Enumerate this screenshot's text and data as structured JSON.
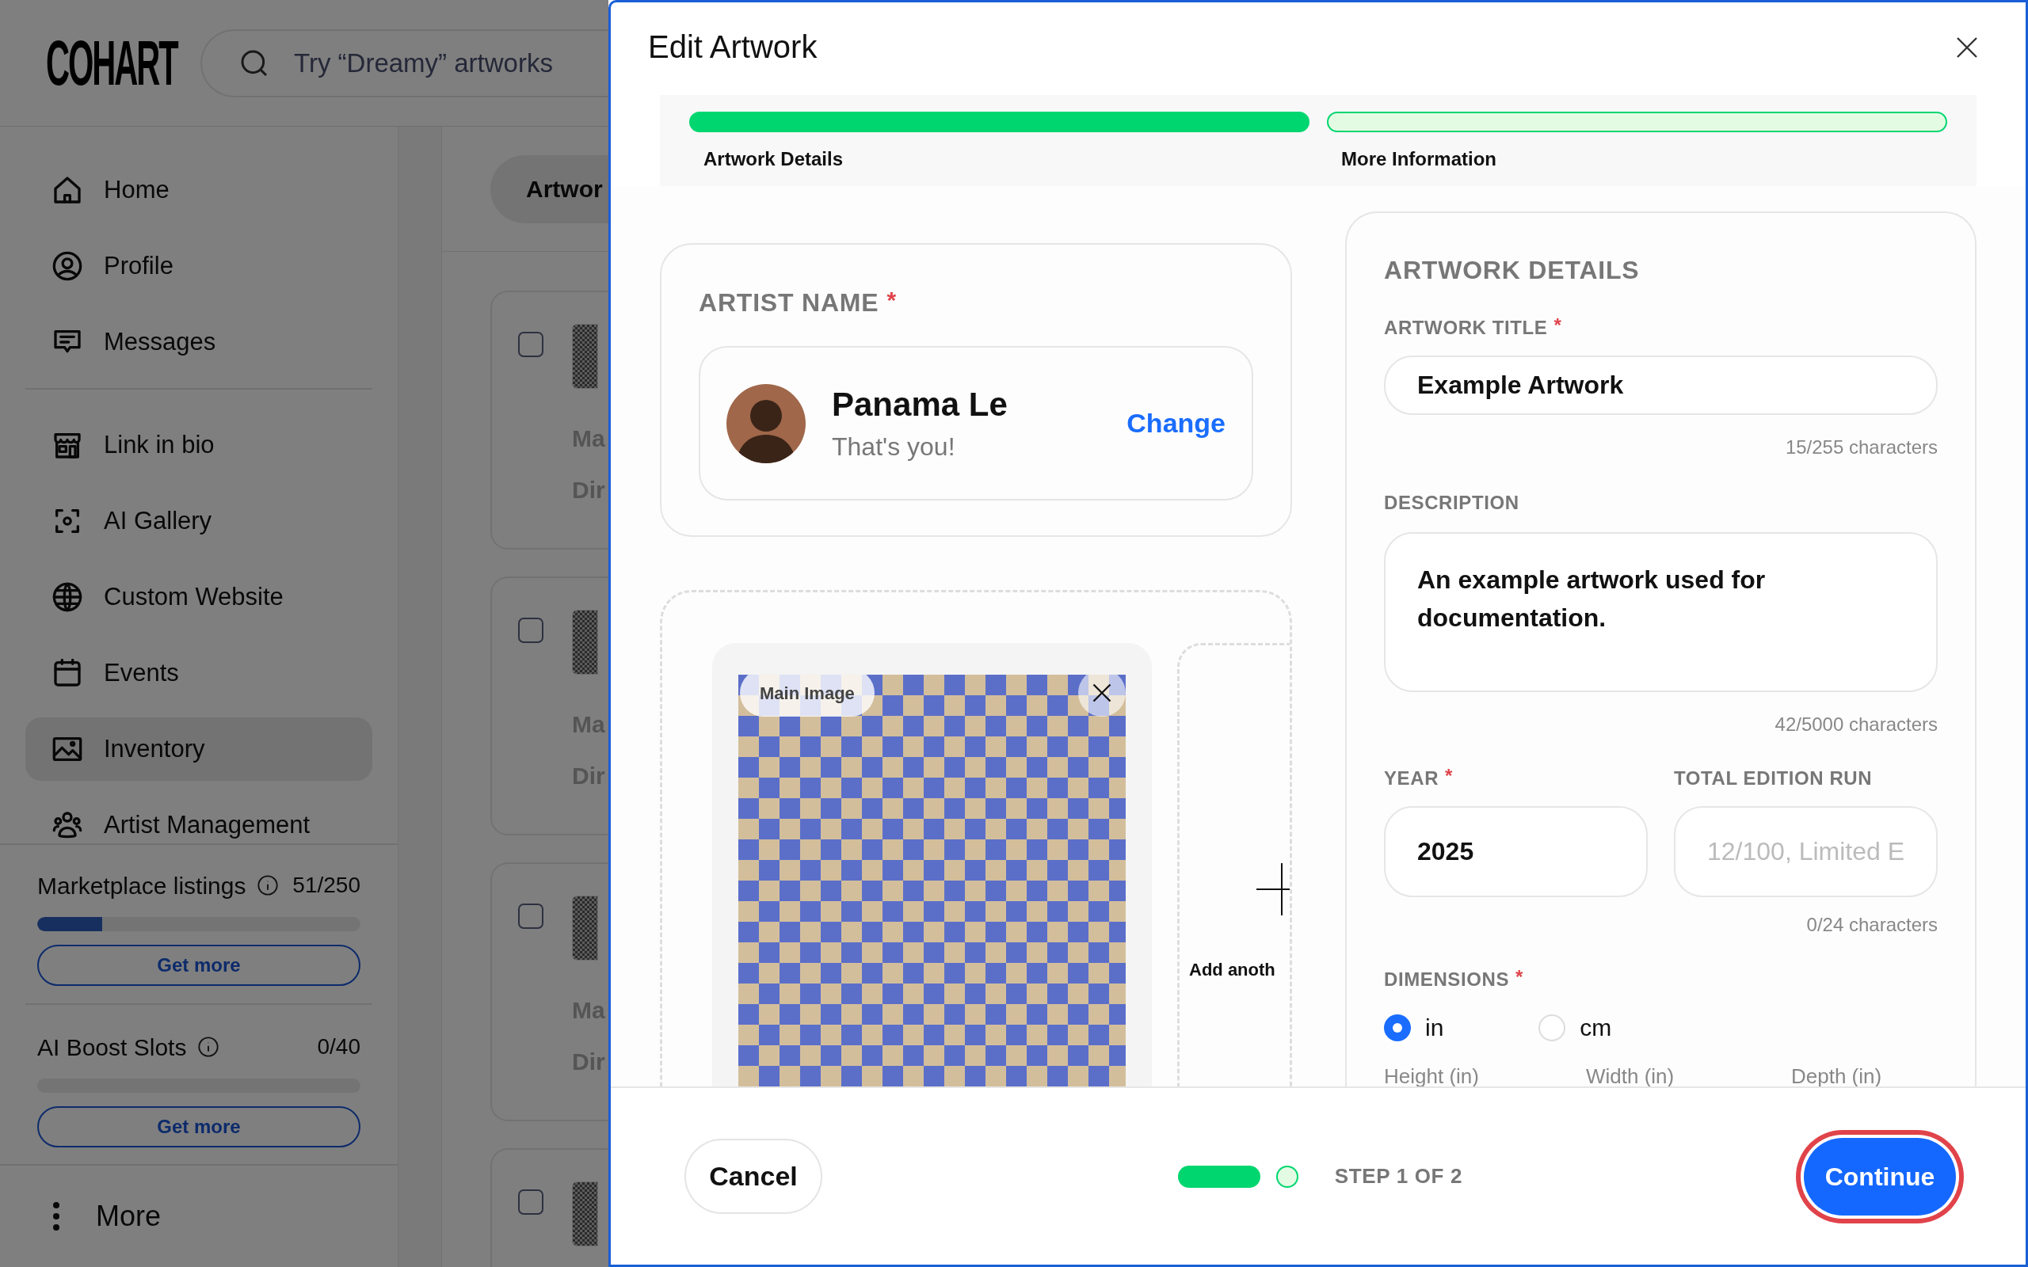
{
  "app": {
    "logo": "COHART",
    "search": {
      "placeholder": "Try “Dreamy” artworks"
    },
    "sidebar": {
      "groups": [
        {
          "items": [
            {
              "label": "Home",
              "selected": false
            },
            {
              "label": "Profile",
              "selected": false
            },
            {
              "label": "Messages",
              "selected": false
            }
          ]
        },
        {
          "items": [
            {
              "label": "Link in bio",
              "selected": false
            },
            {
              "label": "AI Gallery",
              "selected": false
            },
            {
              "label": "Custom Website",
              "selected": false
            },
            {
              "label": "Events",
              "selected": false
            },
            {
              "label": "Inventory",
              "selected": true
            },
            {
              "label": "Artist Management",
              "selected": false
            }
          ]
        }
      ]
    },
    "quotas": [
      {
        "label": "Marketplace listings",
        "count": "51/250",
        "level": 0.2,
        "button": "Get more"
      },
      {
        "label": "AI Boost Slots",
        "count": "0/40",
        "level": 0,
        "button": "Get more"
      }
    ],
    "more": "More",
    "tabs": [
      {
        "label": "Artwor",
        "selected": true
      }
    ],
    "cards": [
      {
        "checked": false,
        "line_1": "Ma",
        "line_2": "Dir"
      },
      {
        "checked": false,
        "line_1": "Ma",
        "line_2": "Dir"
      },
      {
        "checked": false,
        "line_1": "Ma",
        "line_2": "Dir"
      },
      {
        "checked": false
      }
    ]
  },
  "modal": {
    "title": "Edit Artwork",
    "steps": [
      {
        "label": "Artwork Details",
        "done": true
      },
      {
        "label": "More Information",
        "done": false
      }
    ],
    "artist": {
      "label": "ARTIST NAME",
      "required_mark": "*",
      "name": "Panama Le",
      "note": "That's you!",
      "action": "Change"
    },
    "images": [
      {
        "kind": "picture",
        "badge": "Main Image"
      }
    ],
    "add_image": "Add anoth",
    "details": {
      "heading": "ARTWORK DETAILS",
      "title": {
        "label": "ARTWORK TITLE",
        "required_mark": "*",
        "value": "Example Artwork",
        "counter": "15/255 characters"
      },
      "description": {
        "label": "DESCRIPTION",
        "value": "An example artwork used for documentation.",
        "counter": "42/5000 characters"
      },
      "year": {
        "label": "YEAR",
        "required_mark": "*",
        "value": "2025"
      },
      "edition": {
        "label": "TOTAL EDITION RUN",
        "placeholder": "12/100, Limited E",
        "counter": "0/24 characters"
      },
      "dimensions": {
        "label": "DIMENSIONS",
        "required_mark": "*",
        "units": [
          {
            "label": "in",
            "selected": true
          },
          {
            "label": "cm",
            "selected": false
          }
        ],
        "columns": [
          "Height (in)",
          "Width (in)",
          "Depth (in)"
        ]
      }
    },
    "footer": {
      "cancel": "Cancel",
      "dots": [
        {
          "done": true
        },
        {
          "done": false
        }
      ],
      "step_text": "STEP **1** OF **2**",
      "continue": "Continue",
      "focused": true
    }
  }
}
